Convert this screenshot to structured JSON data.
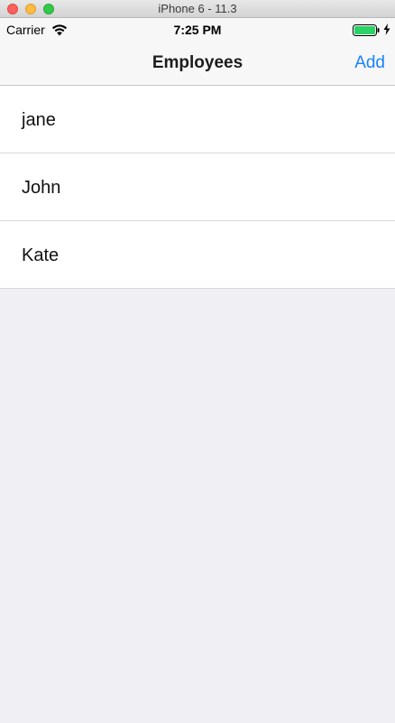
{
  "window": {
    "title": "iPhone 6 - 11.3"
  },
  "status_bar": {
    "carrier": "Carrier",
    "time": "7:25 PM",
    "battery_color": "#2bd265"
  },
  "nav": {
    "title": "Employees",
    "add_label": "Add",
    "accent_color": "#1a82fb"
  },
  "employees": [
    {
      "name": "jane"
    },
    {
      "name": "John"
    },
    {
      "name": "Kate"
    }
  ]
}
